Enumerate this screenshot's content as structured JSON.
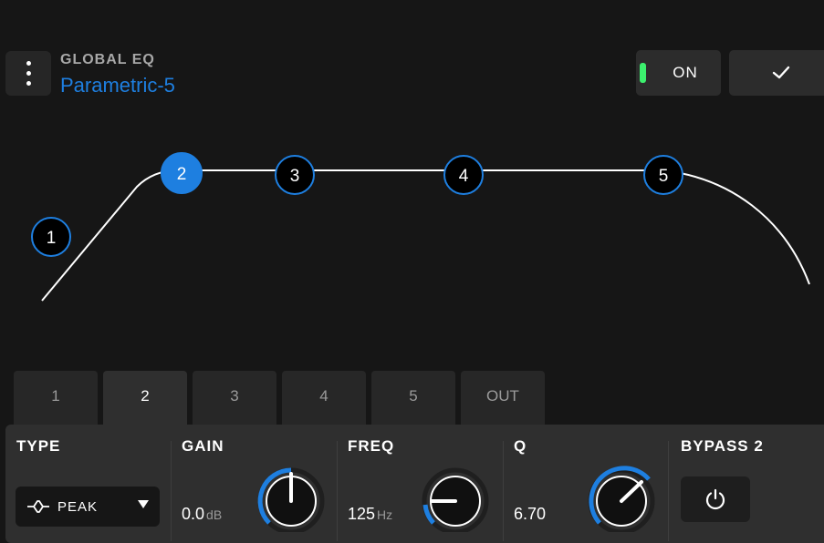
{
  "header": {
    "preset_label": "GLOBAL EQ",
    "preset_name": "Parametric-5",
    "on_label": "ON",
    "menu_icon": "kebab-menu-icon",
    "confirm_icon": "check-icon"
  },
  "colors": {
    "accent": "#1e7fe0",
    "led_on": "#3cf06e",
    "background": "#161616",
    "panel": "#2f2f2f"
  },
  "eq_nodes": [
    {
      "label": "1",
      "selected": false
    },
    {
      "label": "2",
      "selected": true
    },
    {
      "label": "3",
      "selected": false
    },
    {
      "label": "4",
      "selected": false
    },
    {
      "label": "5",
      "selected": false
    }
  ],
  "band_tabs": [
    {
      "label": "1",
      "active": false
    },
    {
      "label": "2",
      "active": true
    },
    {
      "label": "3",
      "active": false
    },
    {
      "label": "4",
      "active": false
    },
    {
      "label": "5",
      "active": false
    },
    {
      "label": "OUT",
      "active": false
    }
  ],
  "controls": {
    "type": {
      "title": "TYPE",
      "value": "PEAK",
      "icon": "peak-filter-icon"
    },
    "gain": {
      "title": "GAIN",
      "value": "0.0",
      "unit": "dB"
    },
    "freq": {
      "title": "FREQ",
      "value": "125",
      "unit": "Hz"
    },
    "q": {
      "title": "Q",
      "value": "6.70"
    },
    "bypass": {
      "title": "BYPASS 2",
      "icon": "power-icon"
    }
  }
}
